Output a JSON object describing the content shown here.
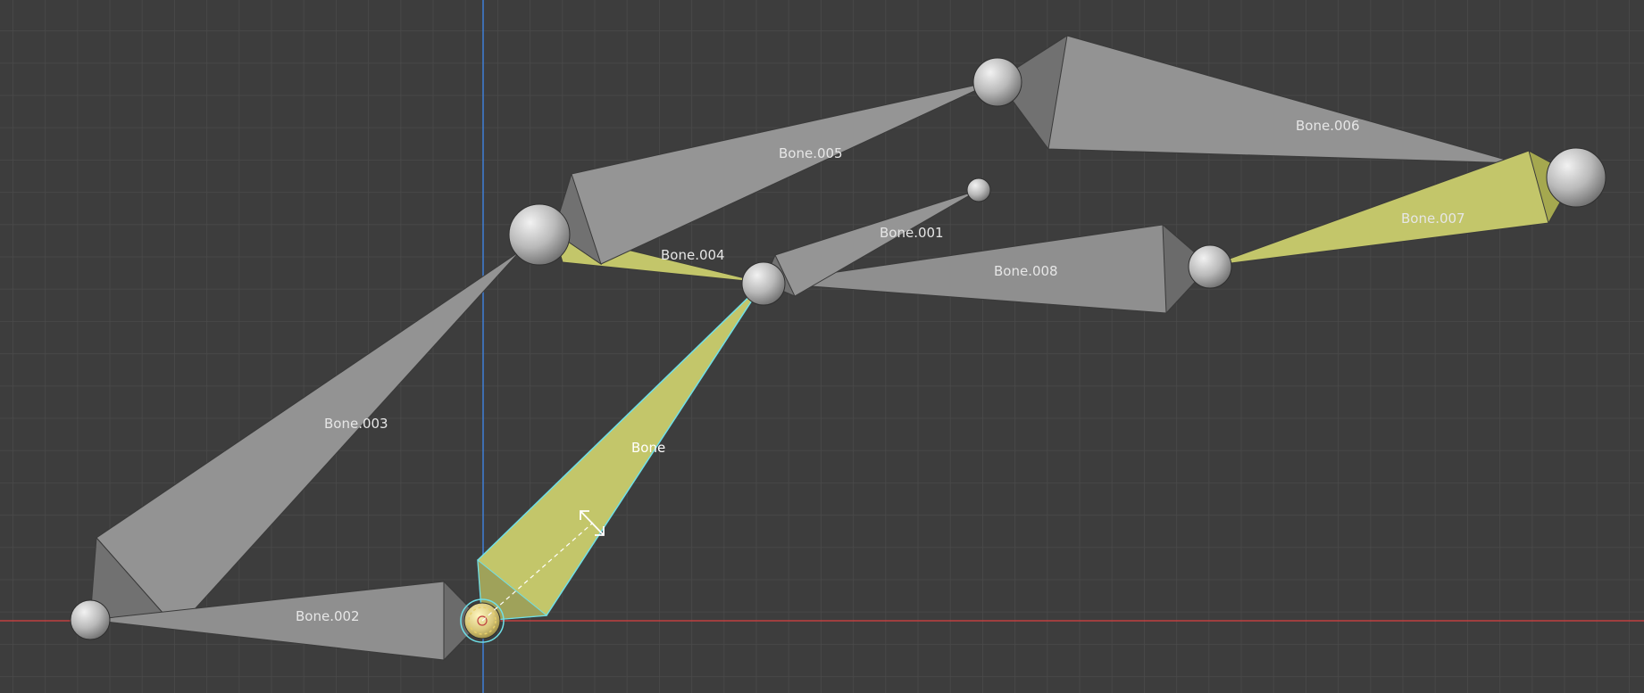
{
  "viewport": {
    "grid": true,
    "background": "#3d3d3d",
    "grid_color": "#4a4a4a",
    "x_axis_color": "#c04040",
    "y_axis_color": "#3f7fd6",
    "bone_color": "#8f8f8f",
    "selected_bone_color": "#c3c66a",
    "active_outline_color": "#6fe0e8",
    "cursor_icon": "scale-cursor-icon"
  },
  "bones": [
    {
      "name": "Bone",
      "selected": true,
      "active": true
    },
    {
      "name": "Bone.001",
      "selected": false,
      "active": false
    },
    {
      "name": "Bone.002",
      "selected": false,
      "active": false
    },
    {
      "name": "Bone.003",
      "selected": false,
      "active": false
    },
    {
      "name": "Bone.004",
      "selected": true,
      "active": false
    },
    {
      "name": "Bone.005",
      "selected": false,
      "active": false
    },
    {
      "name": "Bone.006",
      "selected": false,
      "active": false
    },
    {
      "name": "Bone.007",
      "selected": true,
      "active": false
    },
    {
      "name": "Bone.008",
      "selected": false,
      "active": false
    }
  ]
}
